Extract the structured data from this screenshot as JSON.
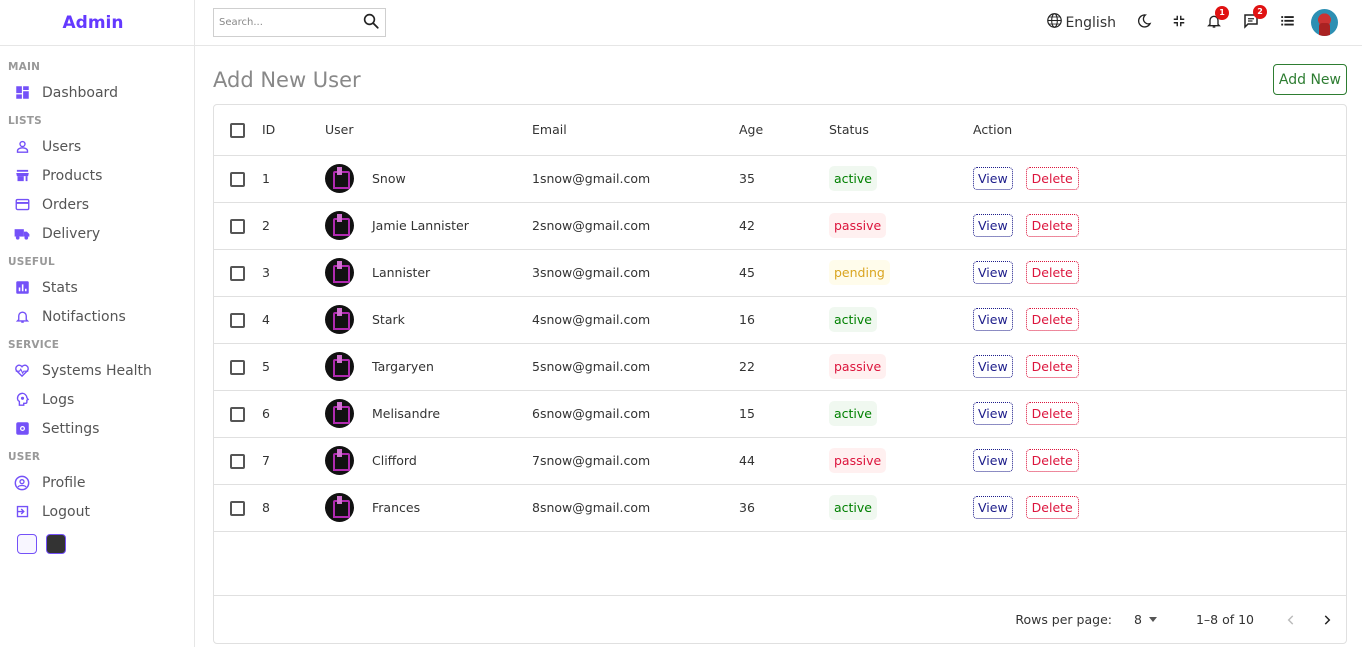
{
  "brand": {
    "logo": "Admin",
    "accent": "#6439ff"
  },
  "sidebar": {
    "sections": [
      {
        "title": "MAIN",
        "items": [
          {
            "label": "Dashboard",
            "icon": "dashboard-icon"
          }
        ]
      },
      {
        "title": "LISTS",
        "items": [
          {
            "label": "Users",
            "icon": "person-icon"
          },
          {
            "label": "Products",
            "icon": "store-icon"
          },
          {
            "label": "Orders",
            "icon": "credit-card-icon"
          },
          {
            "label": "Delivery",
            "icon": "truck-icon"
          }
        ]
      },
      {
        "title": "USEFUL",
        "items": [
          {
            "label": "Stats",
            "icon": "chart-icon"
          },
          {
            "label": "Notifactions",
            "icon": "bell-icon"
          }
        ]
      },
      {
        "title": "SERVICE",
        "items": [
          {
            "label": "Systems Health",
            "icon": "health-icon"
          },
          {
            "label": "Logs",
            "icon": "psychology-icon"
          },
          {
            "label": "Settings",
            "icon": "settings-icon"
          }
        ]
      },
      {
        "title": "USER",
        "items": [
          {
            "label": "Profile",
            "icon": "account-circle-icon"
          },
          {
            "label": "Logout",
            "icon": "exit-icon"
          }
        ]
      }
    ],
    "theme_options": [
      "light",
      "dark"
    ]
  },
  "navbar": {
    "search_placeholder": "Search...",
    "language": "English",
    "notifications_count": "1",
    "messages_count": "2"
  },
  "main": {
    "title": "Add New User",
    "add_button": "Add New"
  },
  "table": {
    "columns": [
      "ID",
      "User",
      "Email",
      "Age",
      "Status",
      "Action"
    ],
    "rows": [
      {
        "id": "1",
        "user": "Snow",
        "email": "1snow@gmail.com",
        "age": "35",
        "status": "active"
      },
      {
        "id": "2",
        "user": "Jamie Lannister",
        "email": "2snow@gmail.com",
        "age": "42",
        "status": "passive"
      },
      {
        "id": "3",
        "user": "Lannister",
        "email": "3snow@gmail.com",
        "age": "45",
        "status": "pending"
      },
      {
        "id": "4",
        "user": "Stark",
        "email": "4snow@gmail.com",
        "age": "16",
        "status": "active"
      },
      {
        "id": "5",
        "user": "Targaryen",
        "email": "5snow@gmail.com",
        "age": "22",
        "status": "passive"
      },
      {
        "id": "6",
        "user": "Melisandre",
        "email": "6snow@gmail.com",
        "age": "15",
        "status": "active"
      },
      {
        "id": "7",
        "user": "Clifford",
        "email": "7snow@gmail.com",
        "age": "44",
        "status": "passive"
      },
      {
        "id": "8",
        "user": "Frances",
        "email": "8snow@gmail.com",
        "age": "36",
        "status": "active"
      }
    ],
    "view_label": "View",
    "delete_label": "Delete"
  },
  "footer": {
    "rows_per_page_label": "Rows per page:",
    "rows_per_page_value": "8",
    "range": "1–8 of 10"
  }
}
